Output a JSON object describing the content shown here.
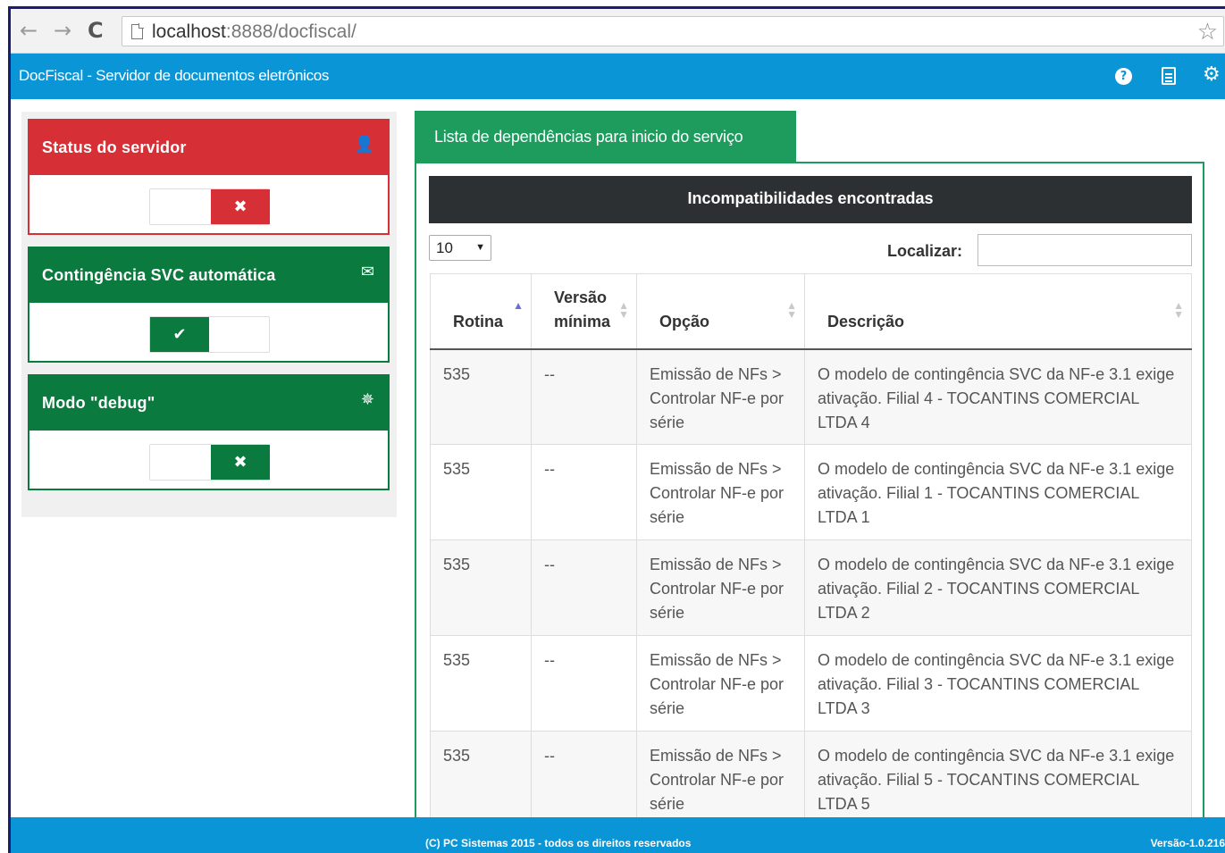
{
  "browser": {
    "url_host": "localhost",
    "url_rest": ":8888/docfiscal/",
    "back_label": "←",
    "forward_label": "→",
    "reload_label": "C",
    "star_glyph": "☆"
  },
  "header": {
    "title": "DocFiscal - Servidor de documentos eletrônicos",
    "icons": [
      "help-icon",
      "document-icon",
      "gear-icon"
    ]
  },
  "sidebar": {
    "panels": [
      {
        "title": "Status do servidor",
        "icon": "user-icon",
        "icon_glyph": "👤",
        "state": "off",
        "knob_glyph": "✖",
        "color": "#d62f36"
      },
      {
        "title": "Contingência SVC automática",
        "icon": "envelope-icon",
        "icon_glyph": "✉",
        "state": "on",
        "knob_glyph": "✔",
        "color": "#0a7a3e"
      },
      {
        "title": "Modo \"debug\"",
        "icon": "bug-icon",
        "icon_glyph": "✵",
        "state": "off",
        "knob_glyph": "✖",
        "color": "#0a7a3e"
      }
    ]
  },
  "main": {
    "tab_label": "Lista de dependências para inicio do serviço",
    "section_title": "Incompatibilidades encontradas",
    "page_size": "10",
    "search_label": "Localizar:",
    "search_value": "",
    "columns": [
      "Rotina",
      "Versão mínima",
      "Opção",
      "Descrição"
    ],
    "rows": [
      {
        "rotina": "535",
        "versao": "--",
        "opcao": "Emissão de NFs > Controlar NF-e por série",
        "descricao": "O modelo de contingência SVC da NF-e 3.1 exige ativação. Filial 4 - TOCANTINS COMERCIAL LTDA 4"
      },
      {
        "rotina": "535",
        "versao": "--",
        "opcao": "Emissão de NFs > Controlar NF-e por série",
        "descricao": "O modelo de contingência SVC da NF-e 3.1 exige ativação. Filial 1 - TOCANTINS COMERCIAL LTDA 1"
      },
      {
        "rotina": "535",
        "versao": "--",
        "opcao": "Emissão de NFs > Controlar NF-e por série",
        "descricao": "O modelo de contingência SVC da NF-e 3.1 exige ativação. Filial 2 - TOCANTINS COMERCIAL LTDA 2"
      },
      {
        "rotina": "535",
        "versao": "--",
        "opcao": "Emissão de NFs > Controlar NF-e por série",
        "descricao": "O modelo de contingência SVC da NF-e 3.1 exige ativação. Filial 3 - TOCANTINS COMERCIAL LTDA 3"
      },
      {
        "rotina": "535",
        "versao": "--",
        "opcao": "Emissão de NFs > Controlar NF-e por série",
        "descricao": "O modelo de contingência SVC da NF-e 3.1 exige ativação. Filial 5 - TOCANTINS COMERCIAL LTDA 5"
      }
    ]
  },
  "footer": {
    "copyright": "(C) PC Sistemas 2015 - todos os direitos reservados",
    "version": "Versão-1.0.216"
  },
  "colors": {
    "header_blue": "#0a95d6",
    "danger_red": "#d62f36",
    "success_green": "#0a7a3e",
    "tab_green": "#1d9c5e",
    "dark_bar": "#2d3033"
  }
}
